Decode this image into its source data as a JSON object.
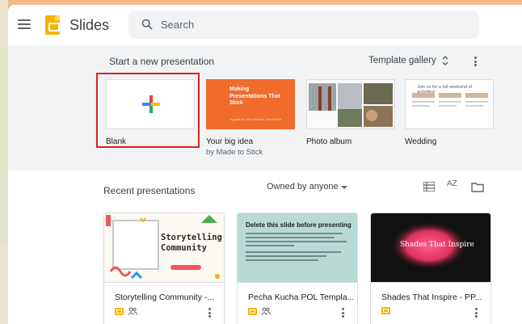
{
  "app": {
    "name": "Slides",
    "brand_color": "#f4b400"
  },
  "search": {
    "placeholder": "Search"
  },
  "new_section": {
    "title": "Start a new presentation",
    "template_gallery_label": "Template gallery",
    "templates": [
      {
        "label": "Blank",
        "sub": ""
      },
      {
        "label": "Your big idea",
        "sub": "by Made to Stick",
        "thumb_title": "Making Presentations That Stick",
        "thumb_sub": "A guide by Chip Heath & Dan Heath"
      },
      {
        "label": "Photo album",
        "sub": ""
      },
      {
        "label": "Wedding",
        "sub": "",
        "thumb_title": "Join us for a full weekend of activities!"
      }
    ]
  },
  "recent_section": {
    "title": "Recent presentations",
    "owner_filter": "Owned by anyone",
    "sort_icon_label": "AZ",
    "docs": [
      {
        "title": "Storytelling Community -...",
        "thumb_text_1": "Storytelling",
        "thumb_text_2": "Community",
        "shared": true
      },
      {
        "title": "Pecha Kucha POL Templa...",
        "thumb_text": "Delete this slide before presenting",
        "shared": true
      },
      {
        "title": "Shades That Inspire - PP...",
        "thumb_text": "Shades That Inspire",
        "shared": false
      }
    ]
  },
  "colors": {
    "highlight": "#e02020",
    "big_idea_orange": "#f06b2c"
  }
}
